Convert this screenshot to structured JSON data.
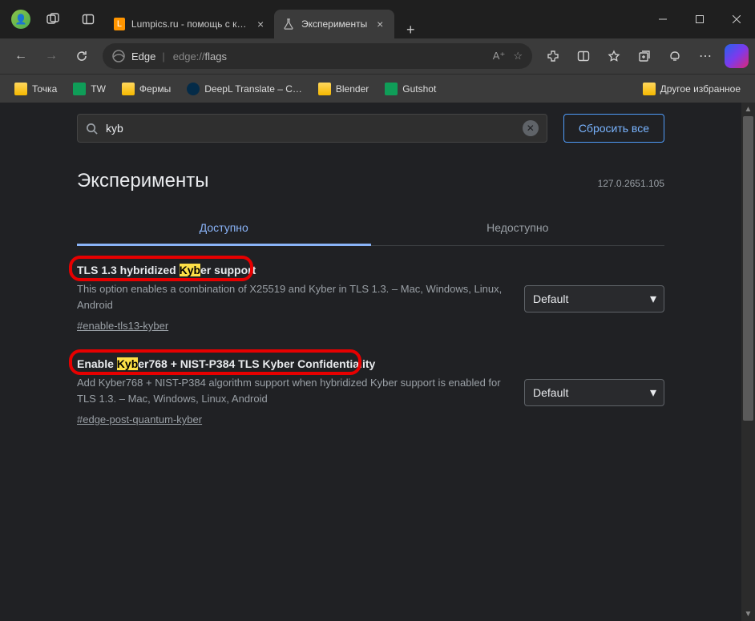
{
  "browser": {
    "name": "Edge",
    "url_prefix": "edge://",
    "url_path": "flags"
  },
  "tabs": [
    {
      "title": "Lumpics.ru - помощь с компью",
      "active": false
    },
    {
      "title": "Эксперименты",
      "active": true
    }
  ],
  "bookmarks": {
    "left": [
      {
        "label": "Точка",
        "icon": "folder"
      },
      {
        "label": "TW",
        "icon": "sheet"
      },
      {
        "label": "Фермы",
        "icon": "folder"
      },
      {
        "label": "DeepL Translate – C…",
        "icon": "deepl"
      },
      {
        "label": "Blender",
        "icon": "folder"
      },
      {
        "label": "Gutshot",
        "icon": "sheet"
      }
    ],
    "right": {
      "label": "Другое избранное",
      "icon": "folder"
    }
  },
  "page": {
    "title": "Эксперименты",
    "version": "127.0.2651.105",
    "search_value": "kyb",
    "reset_label": "Сбросить все",
    "tabs": {
      "available": "Доступно",
      "unavailable": "Недоступно"
    }
  },
  "flags": [
    {
      "title_pre": "TLS 1.3 hybridized ",
      "title_hl": "Kyb",
      "title_post": "er support",
      "desc": "This option enables a combination of X25519 and Kyber in TLS 1.3. – Mac, Windows, Linux, Android",
      "link": "#enable-tls13-kyber",
      "value": "Default"
    },
    {
      "title_pre": "Enable ",
      "title_hl": "Kyb",
      "title_post": "er768 + NIST-P384 TLS Kyber Confidentiality",
      "desc": "Add Kyber768 + NIST-P384 algorithm support when hybridized Kyber support is enabled for TLS 1.3. – Mac, Windows, Linux, Android",
      "link": "#edge-post-quantum-kyber",
      "value": "Default"
    }
  ]
}
